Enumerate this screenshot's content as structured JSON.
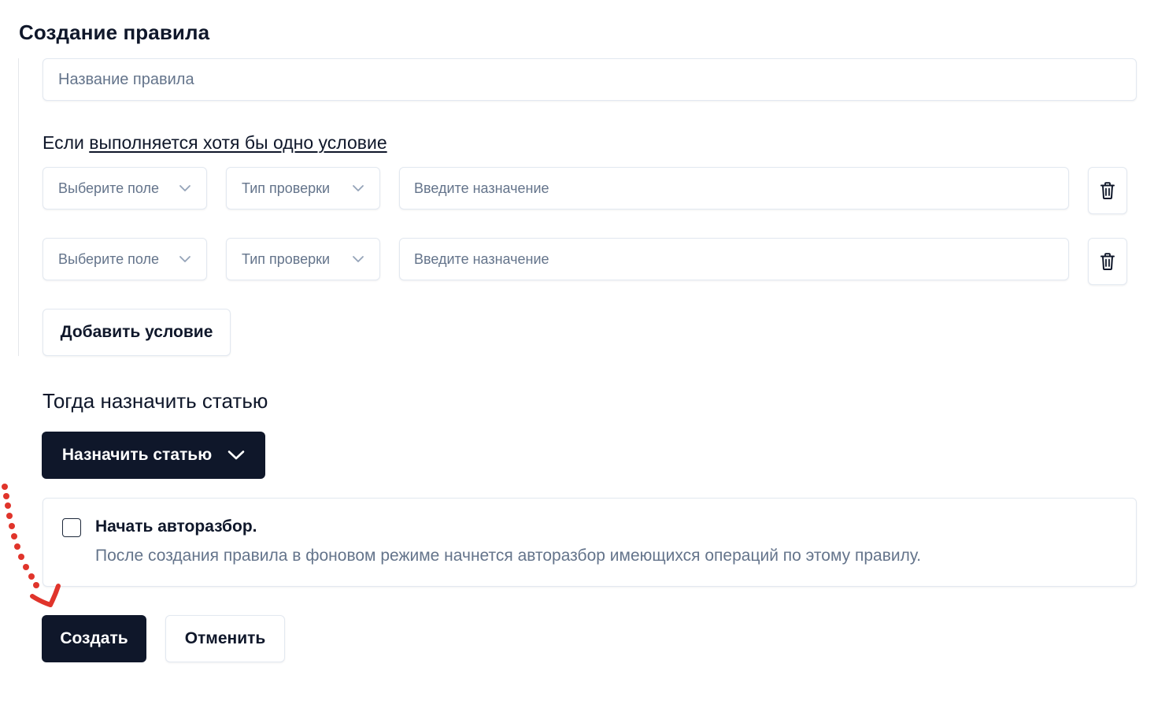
{
  "page": {
    "title": "Создание правила"
  },
  "rule_name": {
    "placeholder": "Название правила",
    "value": ""
  },
  "conditions": {
    "heading_prefix": "Если",
    "mode_link": "выполняется хотя бы одно условие",
    "rows": [
      {
        "field_select": "Выберите поле",
        "check_type_select": "Тип проверки",
        "value_placeholder": "Введите назначение",
        "value": ""
      },
      {
        "field_select": "Выберите поле",
        "check_type_select": "Тип проверки",
        "value_placeholder": "Введите назначение",
        "value": ""
      }
    ],
    "add_button": "Добавить условие"
  },
  "assign": {
    "heading": "Тогда назначить статью",
    "dropdown_label": "Назначить статью"
  },
  "autoparse": {
    "checked": false,
    "title": "Начать авторазбор.",
    "description": "После создания правила в фоновом режиме начнется авторазбор имеющихся операций по этому правилу."
  },
  "actions": {
    "create": "Создать",
    "cancel": "Отменить"
  },
  "colors": {
    "primary_dark": "#0f172a",
    "border": "#e2e8f0",
    "muted_text": "#64748b",
    "annotation_red": "#e0342b"
  },
  "icons": {
    "select_chevron": "chevron-down-icon",
    "delete": "trash-icon",
    "dropdown_chevron": "chevron-down-icon",
    "annotation": "dotted-arrow-icon"
  }
}
